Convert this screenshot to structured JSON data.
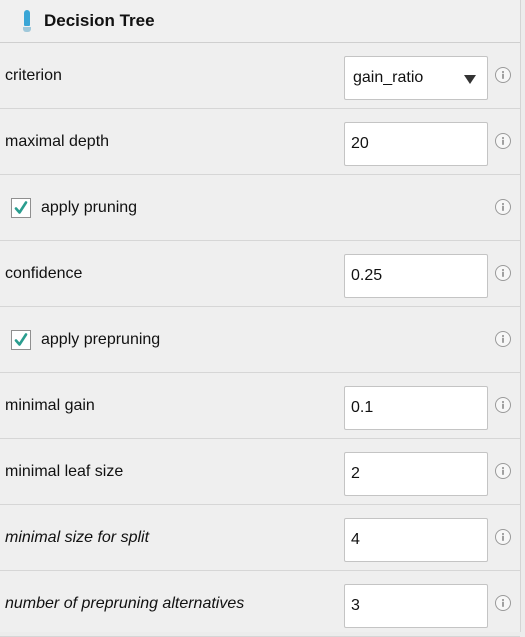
{
  "operator": {
    "title": "Decision Tree",
    "icon": "decision-tree-icon"
  },
  "parameters": [
    {
      "label": "criterion",
      "type": "select",
      "value": "gain_ratio"
    },
    {
      "label": "maximal depth",
      "type": "number",
      "value": "20"
    },
    {
      "label": "apply pruning",
      "type": "checkbox",
      "checked": true
    },
    {
      "label": "confidence",
      "type": "number",
      "value": "0.25"
    },
    {
      "label": "apply prepruning",
      "type": "checkbox",
      "checked": true
    },
    {
      "label": "minimal gain",
      "type": "number",
      "value": "0.1"
    },
    {
      "label": "minimal leaf size",
      "type": "number",
      "value": "2"
    },
    {
      "label": "minimal size for split",
      "type": "number",
      "value": "4",
      "expert": true
    },
    {
      "label": "number of prepruning alternatives",
      "type": "number",
      "value": "3",
      "expert": true
    }
  ],
  "colors": {
    "check": "#2a9d8f",
    "accent": "#3aa6d6"
  }
}
